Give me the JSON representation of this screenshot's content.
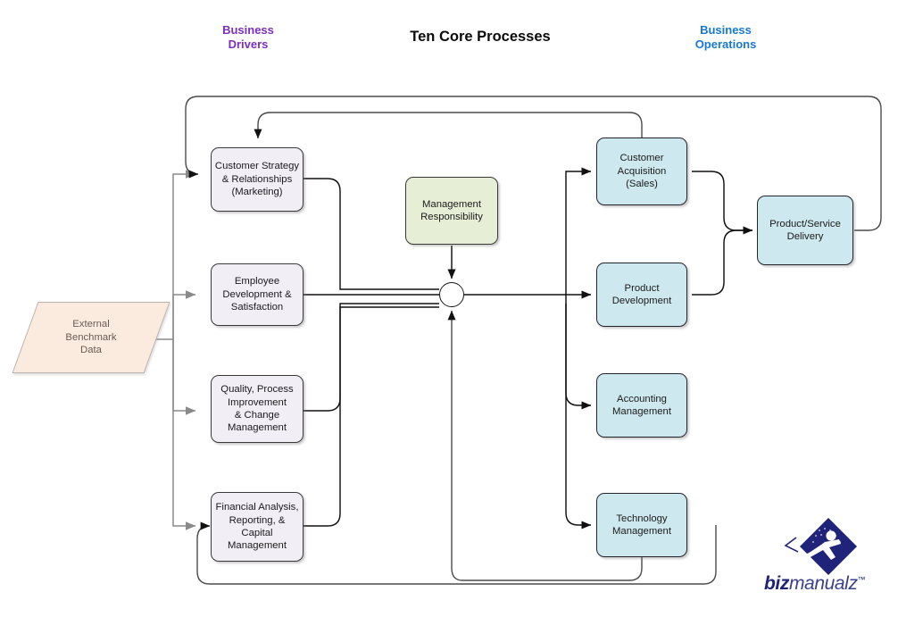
{
  "title": "Ten Core Processes",
  "headers": {
    "left": "Business\nDrivers",
    "right": "Business\nOperations"
  },
  "colors": {
    "driver_header": "#7B2FBE",
    "ops_header": "#1878D2",
    "driver_box_fill": "#f1eef6",
    "ops_box_fill": "#cde8ef",
    "management_box_fill": "#e7eed6",
    "data_shape_fill": "#fbeade",
    "connector_dark": "#111111",
    "connector_gray": "#8a8a8a",
    "logo": "#20237a"
  },
  "input": {
    "external_data": "External\nBenchmark\nData"
  },
  "drivers": [
    {
      "id": "customer-strategy",
      "label": "Customer Strategy\n& Relationships\n(Marketing)"
    },
    {
      "id": "employee-development",
      "label": "Employee\nDevelopment &\nSatisfaction"
    },
    {
      "id": "quality-process",
      "label": "Quality, Process\nImprovement\n& Change\nManagement"
    },
    {
      "id": "financial-analysis",
      "label": "Financial Analysis,\nReporting, &\nCapital\nManagement"
    }
  ],
  "management": {
    "id": "management-responsibility",
    "label": "Management\nResponsibility"
  },
  "operations": [
    {
      "id": "customer-acquisition",
      "label": "Customer\nAcquisition\n(Sales)"
    },
    {
      "id": "product-development",
      "label": "Product\nDevelopment"
    },
    {
      "id": "accounting-management",
      "label": "Accounting\nManagement"
    },
    {
      "id": "technology-management",
      "label": "Technology\nManagement"
    }
  ],
  "delivery": {
    "id": "product-service-delivery",
    "label": "Product/Service\nDelivery"
  },
  "logo": {
    "biz": "biz",
    "manualz": "manualz",
    "tm": "™"
  }
}
